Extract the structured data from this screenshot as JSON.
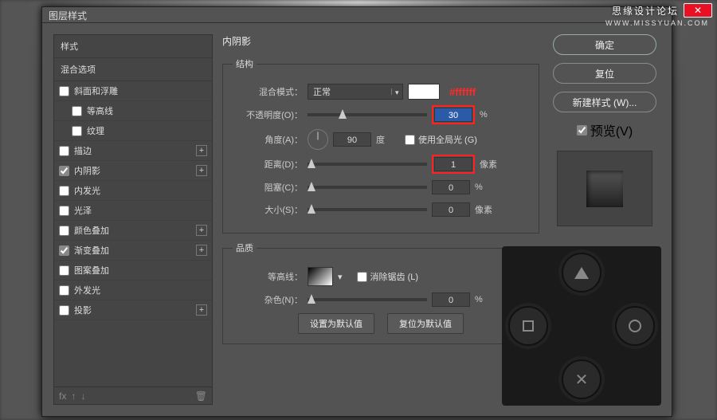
{
  "dialog": {
    "title": "图层样式"
  },
  "watermark": {
    "text": "思缘设计论坛",
    "url": "WWW.MISSYUAN.COM"
  },
  "sidebar": {
    "head_styles": "样式",
    "head_blend": "混合选项",
    "items": [
      {
        "label": "斜面和浮雕",
        "checked": false,
        "plus": false,
        "indent": false
      },
      {
        "label": "等高线",
        "checked": false,
        "plus": false,
        "indent": true
      },
      {
        "label": "纹理",
        "checked": false,
        "plus": false,
        "indent": true
      },
      {
        "label": "描边",
        "checked": false,
        "plus": true,
        "indent": false
      },
      {
        "label": "内阴影",
        "checked": true,
        "plus": true,
        "indent": false
      },
      {
        "label": "内发光",
        "checked": false,
        "plus": false,
        "indent": false
      },
      {
        "label": "光泽",
        "checked": false,
        "plus": false,
        "indent": false
      },
      {
        "label": "颜色叠加",
        "checked": false,
        "plus": true,
        "indent": false
      },
      {
        "label": "渐变叠加",
        "checked": true,
        "plus": true,
        "indent": false
      },
      {
        "label": "图案叠加",
        "checked": false,
        "plus": false,
        "indent": false
      },
      {
        "label": "外发光",
        "checked": false,
        "plus": false,
        "indent": false
      },
      {
        "label": "投影",
        "checked": false,
        "plus": true,
        "indent": false
      }
    ],
    "fx": "fx"
  },
  "center": {
    "panel_title": "内阴影",
    "group_structure": "结构",
    "group_quality": "品质",
    "blend_label": "混合模式：",
    "blend_value": "正常",
    "hex_note": "#ffffff",
    "opacity_label": "不透明度(O)：",
    "opacity_value": "30",
    "opacity_unit": "%",
    "angle_label": "角度(A)：",
    "angle_value": "90",
    "angle_unit": "度",
    "global_light": "使用全局光 (G)",
    "distance_label": "距离(D)：",
    "distance_value": "1",
    "distance_unit": "像素",
    "choke_label": "阻塞(C)：",
    "choke_value": "0",
    "choke_unit": "%",
    "size_label": "大小(S)：",
    "size_value": "0",
    "size_unit": "像素",
    "contour_label": "等高线：",
    "antialias": "消除锯齿 (L)",
    "noise_label": "杂色(N)：",
    "noise_value": "0",
    "noise_unit": "%",
    "btn_default": "设置为默认值",
    "btn_reset": "复位为默认值"
  },
  "right": {
    "ok": "确定",
    "reset": "复位",
    "newstyle": "新建样式 (W)...",
    "preview": "预览(V)"
  }
}
